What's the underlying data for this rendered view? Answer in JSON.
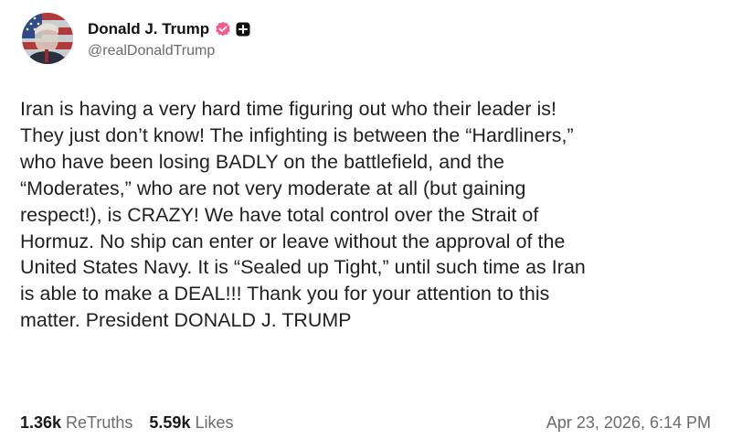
{
  "post": {
    "author": {
      "display_name": "Donald J. Trump",
      "handle": "@realDonaldTrump",
      "verified_badge_icon": "verified-icon",
      "plus_badge_icon": "plus-icon"
    },
    "text": "Iran is having a very hard time figuring out who their leader is!\nThey just don’t know! The infighting is between the “Hardliners,”\nwho have been losing BADLY on the battlefield, and the\n“Moderates,” who are not very moderate at all (but gaining\nrespect!), is CRAZY! We have total control over the Strait of\nHormuz. No ship can enter or leave without the approval of the\nUnited States Navy. It is “Sealed up Tight,” until such time as Iran\nis able to make a DEAL!!! Thank you for your attention to this\nmatter. President DONALD J. TRUMP",
    "stats": {
      "retruths_count": "1.36k",
      "retruths_label": "ReTruths",
      "likes_count": "5.59k",
      "likes_label": "Likes"
    },
    "timestamp": "Apr 23, 2026, 6:14 PM"
  },
  "colors": {
    "verified_badge": "#f25b8a",
    "text_primary": "#1a1a1a",
    "text_secondary": "#6b6b6b"
  }
}
